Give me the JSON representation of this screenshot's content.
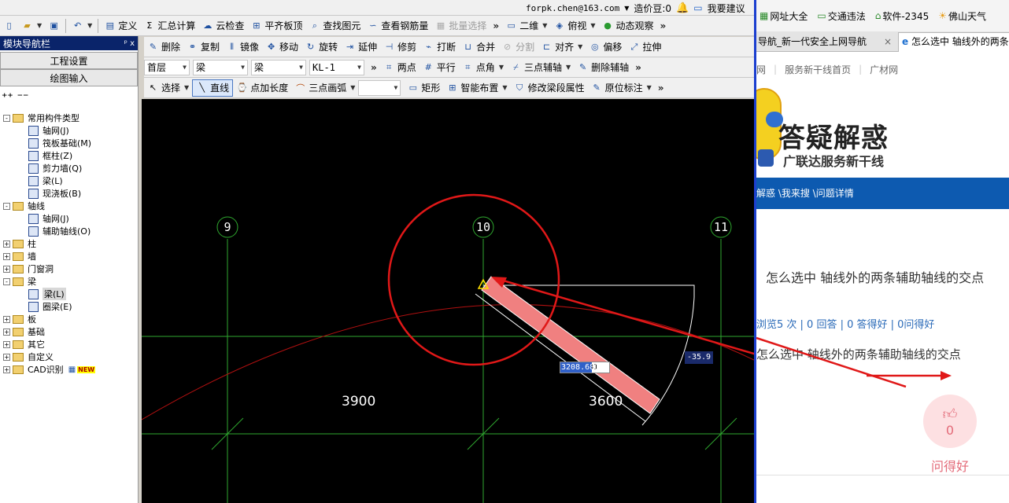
{
  "topbar": {
    "email": "forpk.chen@163.com",
    "coins": "造价豆:0",
    "help": "我要建议"
  },
  "toolbar1": [
    "定义",
    "汇总计算",
    "云检查",
    "平齐板顶",
    "查找图元",
    "查看钢筋量",
    "批量选择",
    "二维",
    "俯视",
    "动态观察"
  ],
  "toolbar2": [
    "删除",
    "复制",
    "镜像",
    "移动",
    "旋转",
    "延伸",
    "修剪",
    "打断",
    "合并",
    "分割",
    "对齐",
    "偏移",
    "拉伸"
  ],
  "toolbar3": {
    "floor": "首层",
    "type1": "梁",
    "type2": "梁",
    "element": "KL-1",
    "tools": [
      "两点",
      "平行",
      "点角",
      "三点辅轴",
      "删除辅轴"
    ]
  },
  "toolbar4": [
    "选择",
    "直线",
    "点加长度",
    "三点画弧",
    "矩形",
    "智能布置",
    "修改梁段属性",
    "原位标注"
  ],
  "nav": {
    "title": "模块导航栏",
    "pin": "ᵖ x",
    "btn1": "工程设置",
    "btn2": "绘图输入",
    "tree": [
      {
        "level": 0,
        "label": "常用构件类型",
        "exp": "-",
        "folder": true
      },
      {
        "level": 1,
        "label": "轴网(J)"
      },
      {
        "level": 1,
        "label": "筏板基础(M)"
      },
      {
        "level": 1,
        "label": "框柱(Z)"
      },
      {
        "level": 1,
        "label": "剪力墙(Q)"
      },
      {
        "level": 1,
        "label": "梁(L)"
      },
      {
        "level": 1,
        "label": "现浇板(B)"
      },
      {
        "level": 0,
        "label": "轴线",
        "exp": "-",
        "folder": true
      },
      {
        "level": 1,
        "label": "轴网(J)"
      },
      {
        "level": 1,
        "label": "辅助轴线(O)"
      },
      {
        "level": 0,
        "label": "柱",
        "exp": "+",
        "folder": true
      },
      {
        "level": 0,
        "label": "墙",
        "exp": "+",
        "folder": true
      },
      {
        "level": 0,
        "label": "门窗洞",
        "exp": "+",
        "folder": true
      },
      {
        "level": 0,
        "label": "梁",
        "exp": "-",
        "folder": true
      },
      {
        "level": 1,
        "label": "梁(L)",
        "selected": true
      },
      {
        "level": 1,
        "label": "圈梁(E)"
      },
      {
        "level": 0,
        "label": "板",
        "exp": "+",
        "folder": true
      },
      {
        "level": 0,
        "label": "基础",
        "exp": "+",
        "folder": true
      },
      {
        "level": 0,
        "label": "其它",
        "exp": "+",
        "folder": true
      },
      {
        "level": 0,
        "label": "自定义",
        "exp": "+",
        "folder": true
      },
      {
        "level": 0,
        "label": "CAD识别",
        "exp": "+",
        "folder": true,
        "badge": "NEW"
      }
    ]
  },
  "canvas": {
    "axes": [
      "9",
      "10",
      "11"
    ],
    "dims": [
      "3900",
      "3600"
    ],
    "length_input": "3208.681",
    "angle": "-35.9"
  },
  "browser": {
    "bookmarks": [
      "网址大全",
      "交通违法",
      "软件-2345",
      "佛山天气"
    ],
    "tab1": "导航_新一代安全上网导航",
    "tab2": "怎么选中 轴线外的两条辅助轴线的交点",
    "tab_close": "×",
    "links": [
      "网",
      "服务新干线首页",
      "广材网"
    ],
    "banner_title": "答疑解惑",
    "banner_sub": "广联达服务新干线",
    "breadcrumb": "解惑 \\我来搜 \\问题详情",
    "question_title": "怎么选中 轴线外的两条辅助轴线的交点",
    "stats": "浏览5 次 | 0 回答 | 0 答得好 | 0问得好",
    "question_body": "怎么选中 轴线外的两条辅助轴线的交点",
    "like_count": "0",
    "like_label": "问得好"
  }
}
